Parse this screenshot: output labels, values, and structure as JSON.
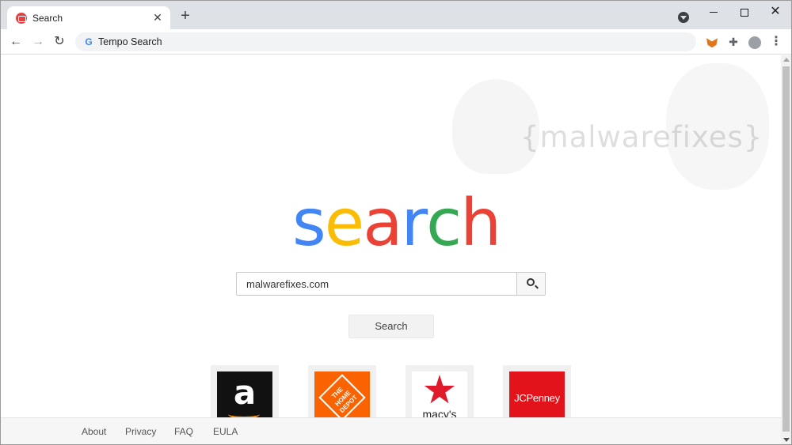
{
  "browser": {
    "tab_title": "Search",
    "new_tab_symbol": "+",
    "close_symbol": "✕",
    "address_text": "Tempo Search",
    "address_icon": "G"
  },
  "page": {
    "watermark_text": "{malwarefixes}",
    "logo_letters": [
      {
        "char": "s",
        "color": "#4285f4"
      },
      {
        "char": "e",
        "color": "#fbbc05"
      },
      {
        "char": "a",
        "color": "#ea4335"
      },
      {
        "char": "r",
        "color": "#4285f4"
      },
      {
        "char": "c",
        "color": "#34a853"
      },
      {
        "char": "h",
        "color": "#ea4335"
      }
    ],
    "search_value": "malwarefixes.com",
    "search_button_label": "Search",
    "tiles": {
      "amazon": "a",
      "homedepot": "THE HOME DEPOT",
      "macys": "macy's",
      "jcpenney": "JCPenney"
    }
  },
  "footer": {
    "about": "About",
    "privacy": "Privacy",
    "faq": "FAQ",
    "eula": "EULA"
  }
}
